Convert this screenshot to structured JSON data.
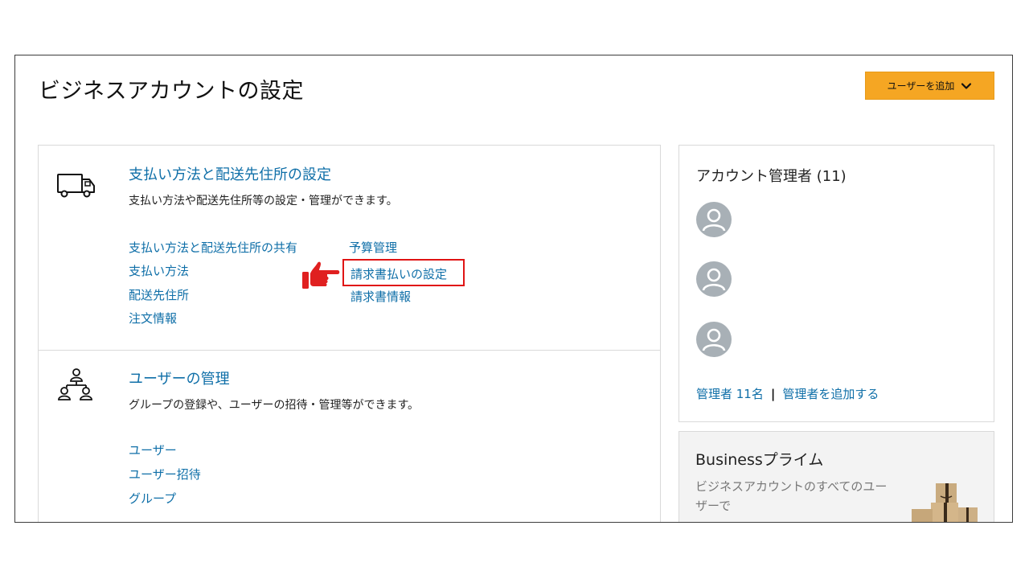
{
  "header": {
    "title": "ビジネスアカウントの設定",
    "add_user_button": "ユーザーを追加",
    "add_user_icon": "chevron-down-icon"
  },
  "payment_section": {
    "icon": "truck-icon",
    "title": "支払い方法と配送先住所の設定",
    "description": "支払い方法や配送先住所等の設定・管理ができます。",
    "links_left": [
      "支払い方法と配送先住所の共有",
      "支払い方法",
      "配送先住所",
      "注文情報"
    ],
    "links_right": [
      "予算管理",
      "請求書払いの設定",
      "請求書情報"
    ],
    "highlighted_link": "請求書払いの設定",
    "pointer_icon": "pointing-hand-icon",
    "highlight_color": "#e01414"
  },
  "users_section": {
    "icon": "user-network-icon",
    "title": "ユーザーの管理",
    "description": "グループの登録や、ユーザーの招待・管理等ができます。",
    "links": [
      "ユーザー",
      "ユーザー招待",
      "グループ"
    ]
  },
  "admins": {
    "title": "アカウント管理者 (11)",
    "avatar_icon": "avatar-icon",
    "avatar_count_shown": 3,
    "count_link": "管理者 11名",
    "separator": "|",
    "add_link": "管理者を追加する"
  },
  "prime": {
    "title": "Businessプライム",
    "description": "ビジネスアカウントのすべてのユーザーで",
    "image": "shipping-boxes-image"
  },
  "colors": {
    "accent_button": "#f5a623",
    "link": "#0f6fa8",
    "highlight": "#e01414"
  }
}
